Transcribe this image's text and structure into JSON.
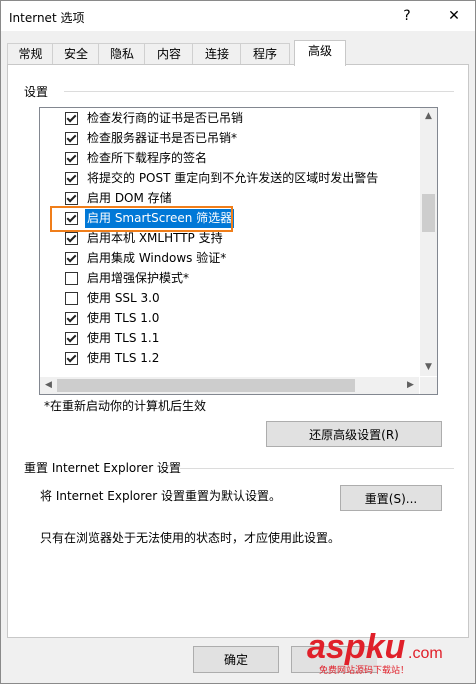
{
  "window": {
    "title": "Internet 选项",
    "help": "?",
    "close": "✕"
  },
  "tabs": [
    {
      "label": "常规"
    },
    {
      "label": "安全"
    },
    {
      "label": "隐私"
    },
    {
      "label": "内容"
    },
    {
      "label": "连接"
    },
    {
      "label": "程序"
    },
    {
      "label": "高级",
      "active": true
    }
  ],
  "settings": {
    "group_label": "设置",
    "items": [
      {
        "label": "检查发行商的证书是否已吊销",
        "checked": true
      },
      {
        "label": "检查服务器证书是否已吊销*",
        "checked": true
      },
      {
        "label": "检查所下载程序的签名",
        "checked": true
      },
      {
        "label": "将提交的 POST 重定向到不允许发送的区域时发出警告",
        "checked": true
      },
      {
        "label": "启用 DOM 存储",
        "checked": true
      },
      {
        "label": "启用 SmartScreen 筛选器",
        "checked": true,
        "selected": true
      },
      {
        "label": "启用本机 XMLHTTP 支持",
        "checked": true
      },
      {
        "label": "启用集成 Windows 验证*",
        "checked": true
      },
      {
        "label": "启用增强保护模式*",
        "checked": false
      },
      {
        "label": "使用 SSL 3.0",
        "checked": false
      },
      {
        "label": "使用 TLS 1.0",
        "checked": true
      },
      {
        "label": "使用 TLS 1.1",
        "checked": true
      },
      {
        "label": "使用 TLS 1.2",
        "checked": true
      }
    ],
    "note": "*在重新启动你的计算机后生效",
    "restore_button": "还原高级设置(R)"
  },
  "reset": {
    "group_label": "重置 Internet Explorer 设置",
    "desc": "将 Internet Explorer 设置重置为默认设置。",
    "reset_button": "重置(S)...",
    "warning": "只有在浏览器处于无法使用的状态时，才应使用此设置。"
  },
  "footer": {
    "ok_button": "确定"
  },
  "watermark": {
    "text": "aspku",
    "suffix": ".com",
    "sub": "免费网站源码下载站！"
  },
  "colors": {
    "selection": "#0078d7",
    "highlight_border": "#f07e1a",
    "watermark_red": "#e0202a"
  }
}
